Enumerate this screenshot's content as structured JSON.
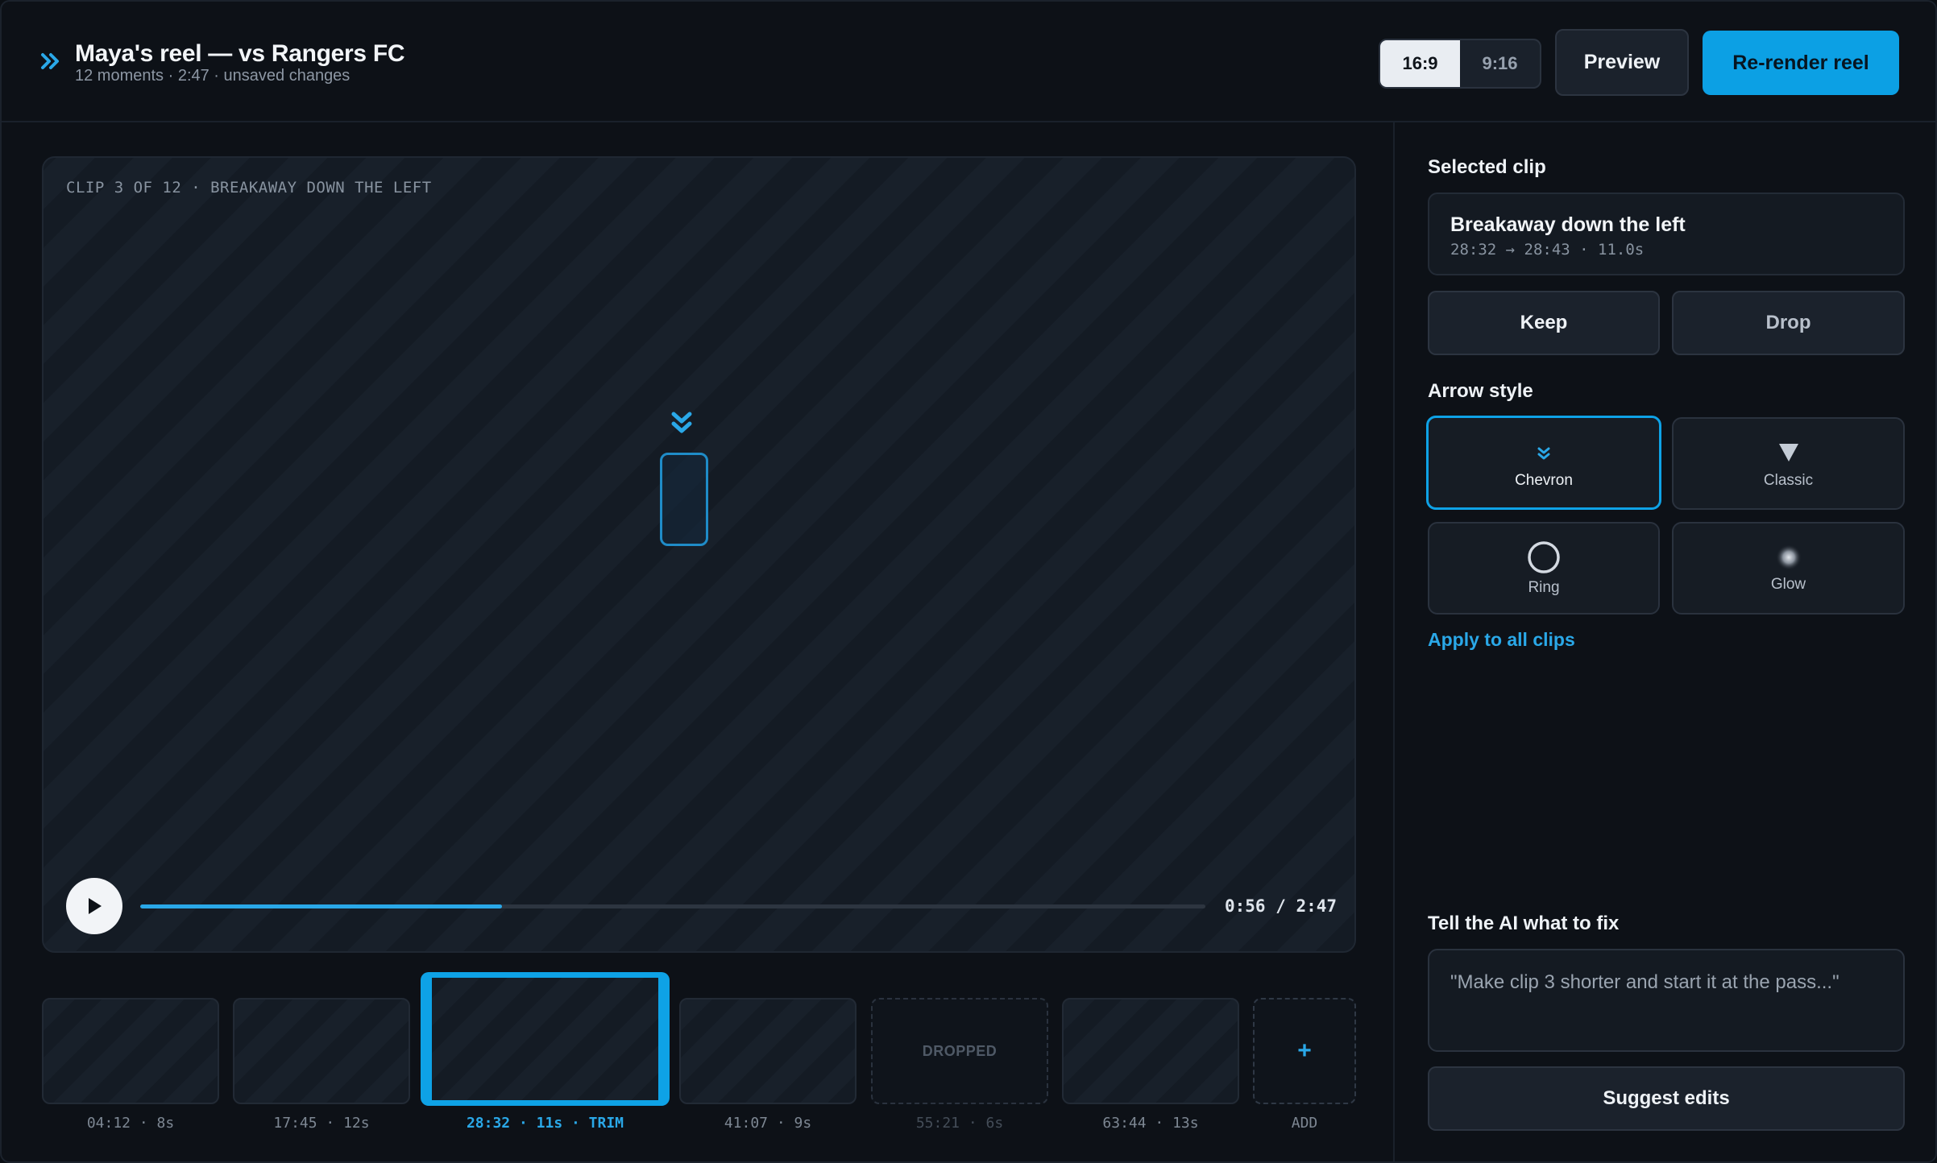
{
  "header": {
    "title": "Maya's reel — vs Rangers FC",
    "subtitle": "12 moments · 2:47 · unsaved changes",
    "ratio_options": [
      "16:9",
      "9:16"
    ],
    "ratio_selected": "16:9",
    "preview_label": "Preview",
    "render_label": "Re-render reel"
  },
  "player": {
    "caption": "CLIP 3 OF 12 · BREAKAWAY DOWN THE LEFT",
    "time_readout": "0:56 / 2:47",
    "progress_fraction": 0.34
  },
  "filmstrip": {
    "clips": [
      {
        "label": "04:12 · 8s",
        "state": "normal"
      },
      {
        "label": "17:45 · 12s",
        "state": "normal"
      },
      {
        "label": "28:32 · 11s · TRIM",
        "state": "selected"
      },
      {
        "label": "41:07 · 9s",
        "state": "normal"
      },
      {
        "label": "55:21 · 6s",
        "state": "dropped",
        "overlay": "DROPPED"
      },
      {
        "label": "63:44 · 13s",
        "state": "normal"
      }
    ],
    "add": {
      "symbol": "+",
      "label": "ADD"
    }
  },
  "side": {
    "selected_heading": "Selected clip",
    "clip_title": "Breakaway down the left",
    "clip_meta": "28:32 → 28:43 · 11.0s",
    "keep_label": "Keep",
    "drop_label": "Drop",
    "arrow_heading": "Arrow style",
    "arrow_styles": [
      {
        "label": "Chevron",
        "icon": "chevron-down-icon",
        "active": true
      },
      {
        "label": "Classic",
        "icon": "triangle-down-icon",
        "active": false
      },
      {
        "label": "Ring",
        "icon": "ring-icon",
        "active": false
      },
      {
        "label": "Glow",
        "icon": "glow-icon",
        "active": false
      }
    ],
    "apply_label": "Apply to all clips",
    "ai_heading": "Tell the AI what to fix",
    "ai_placeholder": "\"Make clip 3 shorter and start it at the pass...\"",
    "suggest_label": "Suggest edits"
  },
  "colors": {
    "accent": "#0ea2e6",
    "background": "#0d1117",
    "panel": "#141a22"
  }
}
